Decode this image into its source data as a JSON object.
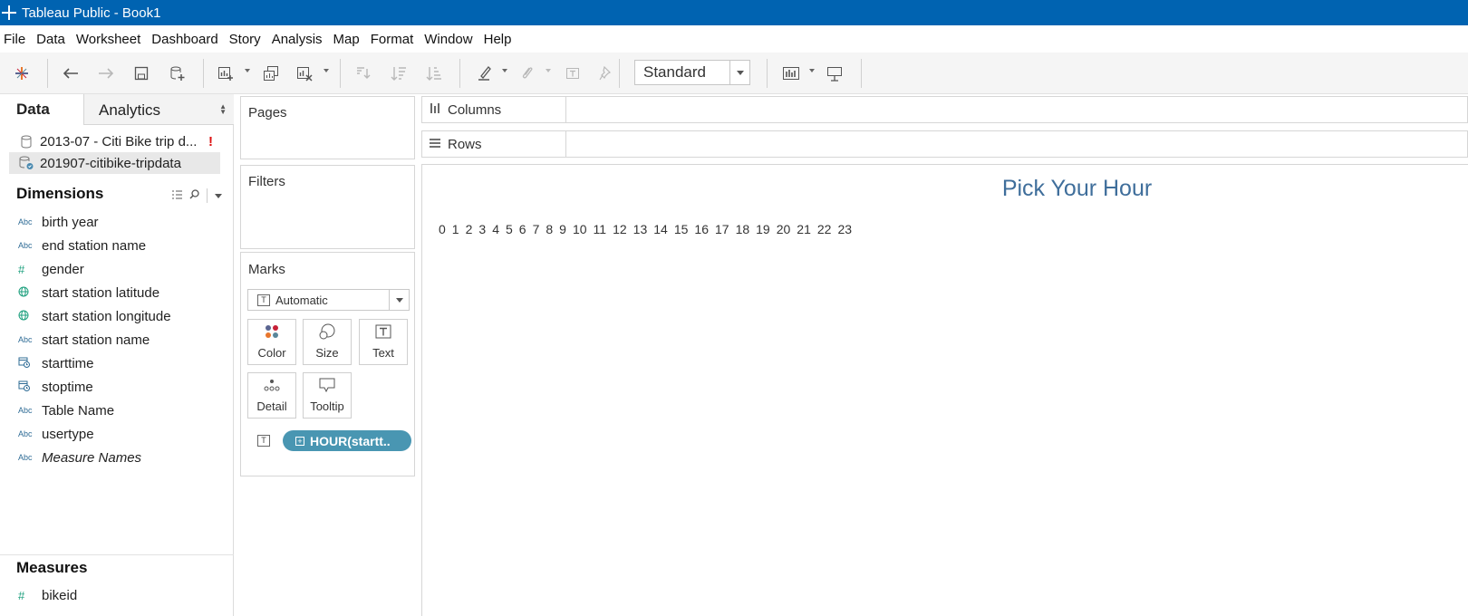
{
  "window": {
    "title": "Tableau Public - Book1"
  },
  "menu": [
    "File",
    "Data",
    "Worksheet",
    "Dashboard",
    "Story",
    "Analysis",
    "Map",
    "Format",
    "Window",
    "Help"
  ],
  "toolbar": {
    "fit_select": "Standard",
    "icons": [
      "tableau-logo-icon",
      "undo-icon",
      "redo-icon",
      "save-icon",
      "new-data-source-icon",
      "new-worksheet-icon",
      "duplicate-sheet-icon",
      "clear-sheet-icon",
      "swap-rows-columns-icon",
      "sort-ascending-icon",
      "sort-descending-icon",
      "highlight-icon",
      "group-members-icon",
      "show-mark-labels-icon",
      "fix-axes-icon",
      "show-me-icon",
      "presentation-mode-icon"
    ]
  },
  "data_pane": {
    "tabs": {
      "data": "Data",
      "analytics": "Analytics"
    },
    "sources": [
      {
        "label": "2013-07 - Citi Bike trip d...",
        "warning": "!"
      },
      {
        "label": "201907-citibike-tripdata"
      }
    ],
    "dimensions_header": "Dimensions",
    "dimensions": [
      {
        "type": "Abc",
        "name": "birth year"
      },
      {
        "type": "#",
        "name": "end station name"
      },
      {
        "type": "#",
        "name": "gender"
      },
      {
        "type": "geo",
        "name": "start station latitude"
      },
      {
        "type": "geo",
        "name": "start station longitude"
      },
      {
        "type": "Abc",
        "name": "start station name"
      },
      {
        "type": "date",
        "name": "starttime"
      },
      {
        "type": "date",
        "name": "stoptime"
      },
      {
        "type": "Abc",
        "name": "Table Name"
      },
      {
        "type": "Abc",
        "name": "usertype"
      },
      {
        "type": "Abc",
        "name": "Measure Names"
      }
    ],
    "measures_header": "Measures",
    "measures": [
      {
        "type": "#",
        "name": "bikeid"
      }
    ]
  },
  "cards": {
    "pages": "Pages",
    "filters": "Filters",
    "marks": {
      "title": "Marks",
      "mark_type": "Automatic",
      "buttons": {
        "color": "Color",
        "size": "Size",
        "text": "Text",
        "detail": "Detail",
        "tooltip": "Tooltip"
      },
      "pill": "HOUR(startt.."
    }
  },
  "shelves": {
    "columns": "Columns",
    "rows": "Rows"
  },
  "view": {
    "title": "Pick Your Hour",
    "hours": [
      "0",
      "1",
      "2",
      "3",
      "4",
      "5",
      "6",
      "7",
      "8",
      "9",
      "10",
      "11",
      "12",
      "13",
      "14",
      "15",
      "16",
      "17",
      "18",
      "19",
      "20",
      "21",
      "22",
      "23"
    ]
  },
  "colors": {
    "titlebar": "#0063b1",
    "pill": "#4996b2",
    "view_title": "#3f6e9b",
    "warning": "#dd1111"
  }
}
